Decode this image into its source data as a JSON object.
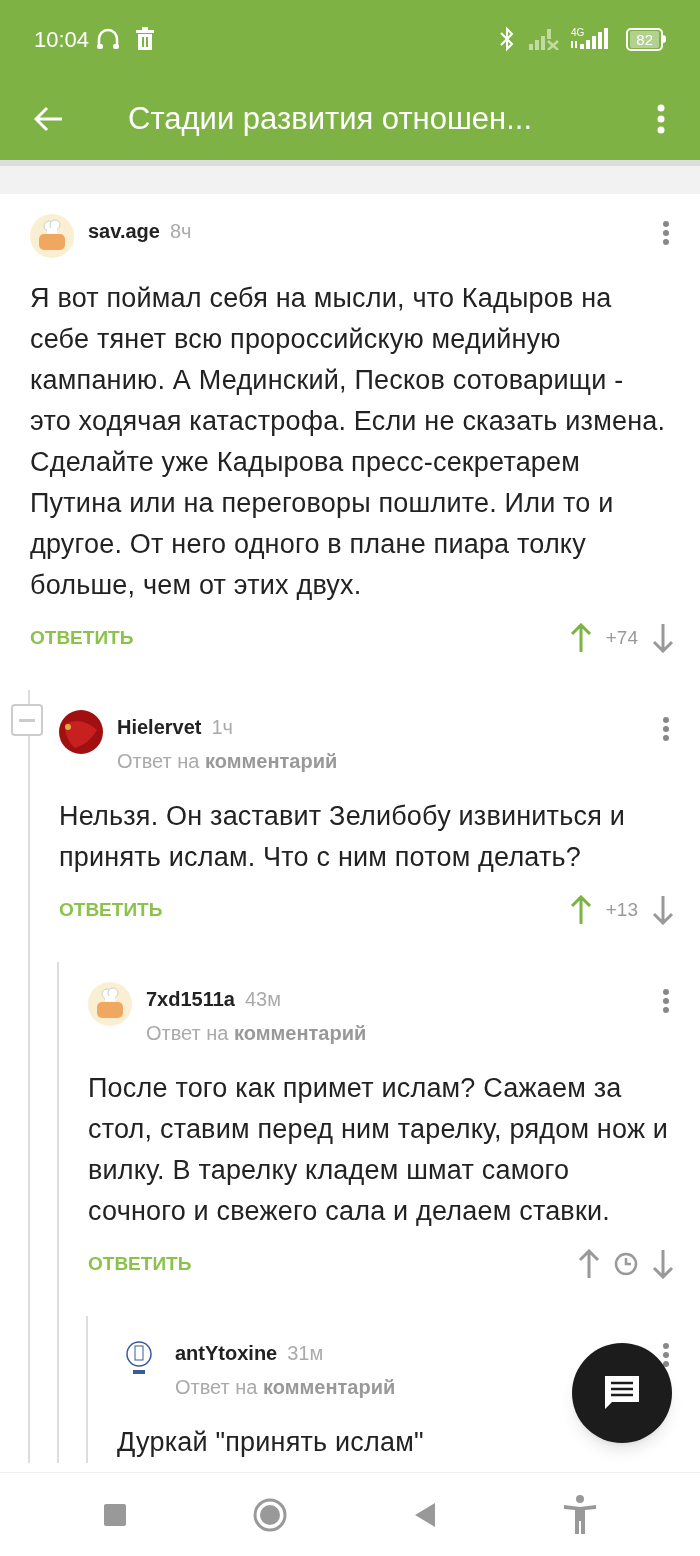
{
  "status_bar": {
    "time": "10:04",
    "network": "4G",
    "battery": "82"
  },
  "app_bar": {
    "title": "Стадии развития отношен..."
  },
  "comments": [
    {
      "author": "sav.age",
      "time": "8ч",
      "body": "Я вот поймал себя на мысли, что Кадыров на себе тянет всю пророссийскую медийную кампанию. А Мединский, Песков сотоварищи - это ходячая катастрофа. Если не сказать измена. Сделайте уже Кадырова пресс-секретарем Путина или на переговоры пошлите. Или то и другое. От него одного в плане пиара толку больше, чем от этих двух.",
      "reply_label": "ОТВЕТИТЬ",
      "rating": "+74",
      "upvoted": true,
      "children": [
        {
          "author": "Hielervet",
          "time": "1ч",
          "reply_to": "Ответ на **комментарий**",
          "body": "Нельзя. Он заставит Зелибобу извиниться и принять ислам. Что с ним потом делать?",
          "reply_label": "ОТВЕТИТЬ",
          "rating": "+13",
          "upvoted": true,
          "collapsible": true,
          "children": [
            {
              "author": "7xd1511a",
              "time": "43м",
              "reply_to": "Ответ на **комментарий**",
              "body": "После того как примет ислам? Сажаем за стол, ставим перед ним тарелку, рядом нож и вилку. В тарелку кладем шмат самого сочного и свежего сала и делаем ставки.",
              "reply_label": "ОТВЕТИТЬ",
              "upvoted": false,
              "children": [
                {
                  "author": "antYtoxine",
                  "time": "31м",
                  "reply_to": "Ответ на **комментарий**",
                  "body": "Дуркай \"принять ислам\""
                }
              ]
            }
          ]
        }
      ]
    }
  ]
}
